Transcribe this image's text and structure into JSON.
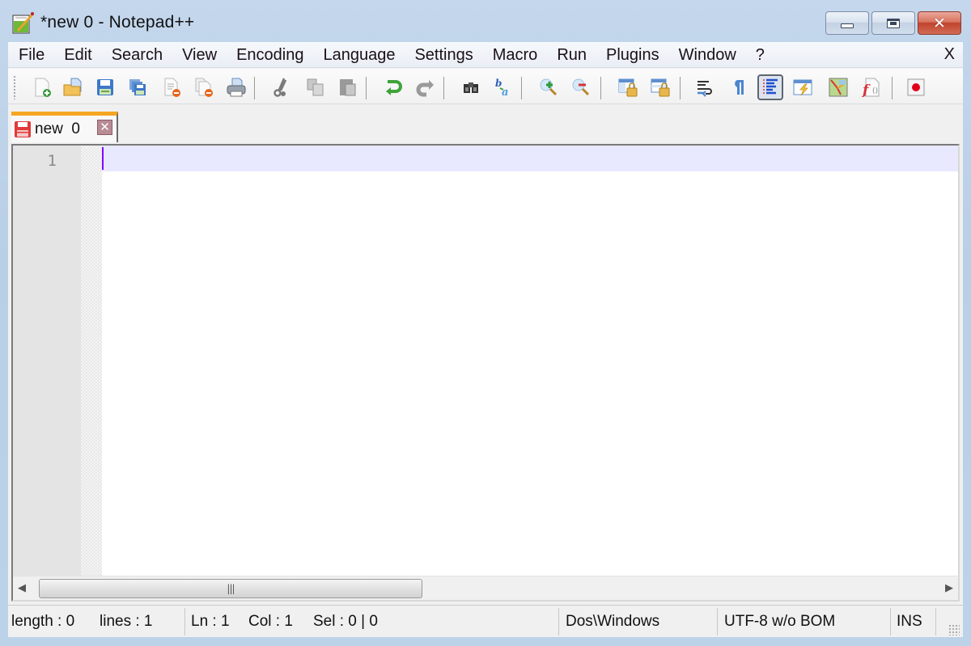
{
  "window": {
    "title": "*new  0 - Notepad++",
    "controls": {
      "minimize": "minimize",
      "maximize": "maximize",
      "close": "close"
    }
  },
  "menu": {
    "items": [
      "File",
      "Edit",
      "Search",
      "View",
      "Encoding",
      "Language",
      "Settings",
      "Macro",
      "Run",
      "Plugins",
      "Window",
      "?"
    ],
    "close_label": "X"
  },
  "toolbar": {
    "buttons": [
      {
        "name": "new-file",
        "tooltip": "New"
      },
      {
        "name": "open-file",
        "tooltip": "Open"
      },
      {
        "name": "save",
        "tooltip": "Save"
      },
      {
        "name": "save-all",
        "tooltip": "Save All"
      },
      {
        "name": "close",
        "tooltip": "Close"
      },
      {
        "name": "close-all",
        "tooltip": "Close All"
      },
      {
        "name": "print",
        "tooltip": "Print"
      },
      {
        "name": "cut",
        "tooltip": "Cut"
      },
      {
        "name": "copy",
        "tooltip": "Copy"
      },
      {
        "name": "paste",
        "tooltip": "Paste"
      },
      {
        "name": "undo",
        "tooltip": "Undo"
      },
      {
        "name": "redo",
        "tooltip": "Redo"
      },
      {
        "name": "find",
        "tooltip": "Find"
      },
      {
        "name": "replace",
        "tooltip": "Replace"
      },
      {
        "name": "zoom-in",
        "tooltip": "Zoom In"
      },
      {
        "name": "zoom-out",
        "tooltip": "Zoom Out"
      },
      {
        "name": "sync-vertical",
        "tooltip": "Synchronize Vertical Scrolling"
      },
      {
        "name": "sync-horizontal",
        "tooltip": "Synchronize Horizontal Scrolling"
      },
      {
        "name": "word-wrap",
        "tooltip": "Word wrap"
      },
      {
        "name": "show-all-chars",
        "tooltip": "Show All Characters"
      },
      {
        "name": "indent-guide",
        "tooltip": "Show Indent Guide",
        "active": true
      },
      {
        "name": "user-defined-language",
        "tooltip": "Define your language"
      },
      {
        "name": "document-map",
        "tooltip": "Document Map"
      },
      {
        "name": "function-list",
        "tooltip": "Function List"
      },
      {
        "name": "macro-record",
        "tooltip": "Start Recording"
      }
    ]
  },
  "tabs": [
    {
      "label": "new  0",
      "modified": true,
      "active": true
    }
  ],
  "editor": {
    "line_numbers": [
      "1"
    ],
    "content": ""
  },
  "statusbar": {
    "length": "length : 0",
    "lines": "lines : 1",
    "ln": "Ln : 1",
    "col": "Col : 1",
    "sel": "Sel : 0 | 0",
    "eol": "Dos\\Windows",
    "encoding": "UTF-8 w/o BOM",
    "mode": "INS"
  },
  "colors": {
    "tab_active_accent": "#f5a623",
    "current_line": "#e8e8ff",
    "caret": "#8000ff",
    "close_button": "#c0432d"
  }
}
